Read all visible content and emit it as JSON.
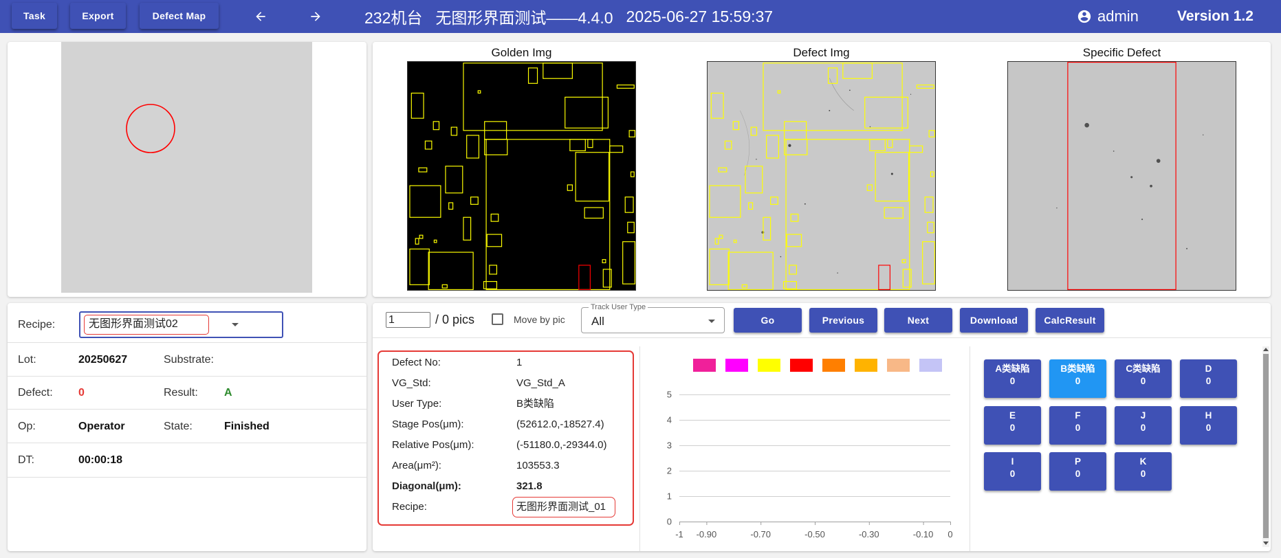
{
  "header": {
    "task_label": "Task",
    "export_label": "Export",
    "defect_map_label": "Defect Map",
    "back_icon": "arrow-left-icon",
    "forward_icon": "arrow-right-icon",
    "title": {
      "machine": "232机台",
      "recipe": "无图形界面测试——4.4.0",
      "datetime": "2025-06-27 15:59:37"
    },
    "user_icon": "account-circle-icon",
    "user": "admin",
    "version": "Version 1.2"
  },
  "lot_info": {
    "recipe_label": "Recipe:",
    "recipe_value": "无图形界面测试02",
    "lot_label": "Lot:",
    "lot_value": "20250627",
    "substrate_label": "Substrate:",
    "defect_label": "Defect:",
    "defect_value": "0",
    "result_label": "Result:",
    "result_value": "A",
    "op_label": "Op:",
    "op_value": "Operator",
    "state_label": "State:",
    "state_value": "Finished",
    "dt_label": "DT:",
    "dt_value": "00:00:18"
  },
  "images": {
    "golden_title": "Golden Img",
    "defect_title": "Defect Img",
    "specific_title": "Specific Defect"
  },
  "toolbar": {
    "page_value": "1",
    "page_total": "/ 0 pics",
    "move_by_pic_label": "Move by pic",
    "move_by_pic_checked": false,
    "track_user_type_label": "Track User Type",
    "track_user_type_value": "All",
    "go_label": "Go",
    "previous_label": "Previous",
    "next_label": "Next",
    "download_label": "Download",
    "calc_result_label": "CalcResult"
  },
  "defect_detail": {
    "rows": [
      {
        "label": "Defect No:",
        "value": "1"
      },
      {
        "label": "VG_Std:",
        "value": "VG_Std_A"
      },
      {
        "label": "User Type:",
        "value": "B类缺陷"
      },
      {
        "label": "Stage Pos(μm):",
        "value": "(52612.0,-18527.4)"
      },
      {
        "label": "Relative Pos(μm):",
        "value": "(-51180.0,-29344.0)"
      },
      {
        "label": "Area(μm²):",
        "value": "103553.3"
      },
      {
        "label": "Diagonal(μm):",
        "value": "321.8"
      },
      {
        "label": "Recipe:",
        "value": "无图形界面测试_01"
      }
    ]
  },
  "distribution_chart": {
    "type": "bar",
    "legend_colors": [
      "#f0209a",
      "#ff00ff",
      "#ffff00",
      "#ff0000",
      "#ff7f00",
      "#ffb300",
      "#f8b887",
      "#c4c4f6"
    ],
    "y_ticks": [
      "0",
      "1",
      "2",
      "3",
      "4",
      "5"
    ],
    "x_ticks": [
      "-1",
      "-0.90",
      "-0.70",
      "-0.50",
      "-0.30",
      "-0.10",
      "0"
    ],
    "xlim": [
      -1,
      0
    ],
    "ylim": [
      0,
      5
    ],
    "grid": true,
    "series": []
  },
  "defect_types": [
    {
      "label": "A类缺陷",
      "count": "0",
      "selected": false
    },
    {
      "label": "B类缺陷",
      "count": "0",
      "selected": true
    },
    {
      "label": "C类缺陷",
      "count": "0",
      "selected": false
    },
    {
      "label": "D",
      "count": "0",
      "selected": false
    },
    {
      "label": "E",
      "count": "0",
      "selected": false
    },
    {
      "label": "F",
      "count": "0",
      "selected": false
    },
    {
      "label": "J",
      "count": "0",
      "selected": false
    },
    {
      "label": "H",
      "count": "0",
      "selected": false
    },
    {
      "label": "I",
      "count": "0",
      "selected": false
    },
    {
      "label": "P",
      "count": "0",
      "selected": false
    },
    {
      "label": "K",
      "count": "0",
      "selected": false
    }
  ],
  "colors": {
    "primary": "#3f51b5",
    "selected": "#2196f3",
    "highlight_border": "#e53935",
    "defect_count": "#e53935",
    "result_ok": "#2e8b2e",
    "layout_box": "#ffff00",
    "defect_box": "#ff0000",
    "wafer": "#d3d3d3"
  }
}
